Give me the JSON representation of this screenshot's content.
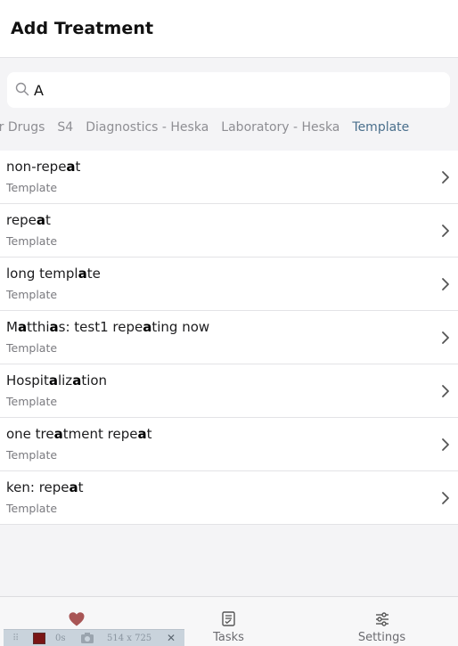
{
  "header": {
    "title": "Add Treatment"
  },
  "search": {
    "value": "A",
    "icon": "search-icon"
  },
  "chips": [
    {
      "label": "er Drugs",
      "active": false
    },
    {
      "label": "S4",
      "active": false
    },
    {
      "label": "Diagnostics - Heska",
      "active": false
    },
    {
      "label": "Laboratory - Heska",
      "active": false
    },
    {
      "label": "Template",
      "active": true
    }
  ],
  "items": [
    {
      "parts": [
        "non-repe",
        "a",
        "t"
      ],
      "subtitle": "Template"
    },
    {
      "parts": [
        "repe",
        "a",
        "t"
      ],
      "subtitle": "Template"
    },
    {
      "parts": [
        "long templ",
        "a",
        "te"
      ],
      "subtitle": "Template"
    },
    {
      "parts": [
        "M",
        "a",
        "tthi",
        "a",
        "s: test1 repe",
        "a",
        "ting now"
      ],
      "subtitle": "Template"
    },
    {
      "parts": [
        "Hospit",
        "a",
        "liz",
        "a",
        "tion"
      ],
      "subtitle": "Template"
    },
    {
      "parts": [
        "one tre",
        "a",
        "tment repe",
        "a",
        "t"
      ],
      "subtitle": "Template"
    },
    {
      "parts": [
        "ken: repe",
        "a",
        "t"
      ],
      "subtitle": "Template"
    }
  ],
  "tabbar": {
    "tabs": [
      {
        "label": "",
        "icon": "heart-icon",
        "active": true
      },
      {
        "label": "Tasks",
        "icon": "tasks-icon",
        "active": false
      },
      {
        "label": "Settings",
        "icon": "settings-icon",
        "active": false
      }
    ]
  },
  "devtools": {
    "time": "0s",
    "size": "514 x 725"
  },
  "colors": {
    "accent": "#4a6f8c",
    "heart": "#a85555"
  }
}
